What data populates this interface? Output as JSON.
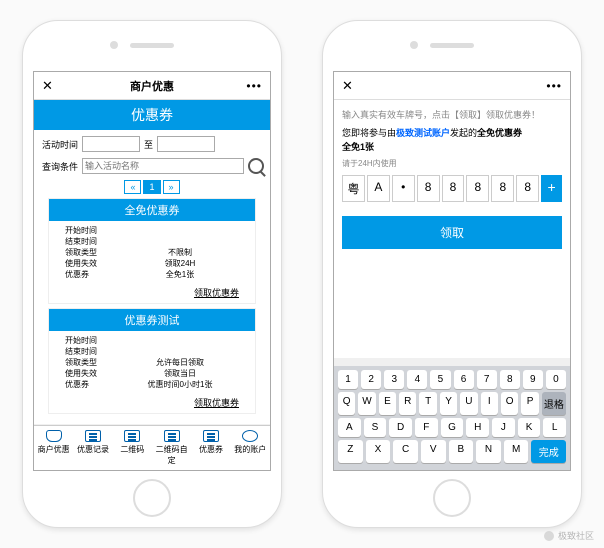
{
  "watermark": "极致社区",
  "left": {
    "nav": {
      "close": "✕",
      "title": "商户优惠",
      "more": "•••"
    },
    "header": "优惠券",
    "searchform": {
      "time_label": "活动时间",
      "to": "至",
      "cond_label": "查询条件",
      "cond_placeholder": "输入活动名称"
    },
    "pager": {
      "prev": "«",
      "page": "1",
      "next": "»"
    },
    "coupons": [
      {
        "title": "全免优惠券",
        "rows": [
          {
            "k": "开始时间",
            "v": ""
          },
          {
            "k": "结束时间",
            "v": ""
          },
          {
            "k": "领取类型",
            "v": "不限制"
          },
          {
            "k": "使用失效",
            "v": "领取24H"
          },
          {
            "k": "优惠券",
            "v": "全免1张"
          }
        ],
        "action": "领取优惠券"
      },
      {
        "title": "优惠券测试",
        "rows": [
          {
            "k": "开始时间",
            "v": ""
          },
          {
            "k": "结束时间",
            "v": ""
          },
          {
            "k": "领取类型",
            "v": "允许每日领取"
          },
          {
            "k": "使用失效",
            "v": "领取当日"
          },
          {
            "k": "优惠券",
            "v": "优惠时间0小时1张"
          }
        ],
        "action": "领取优惠券"
      }
    ],
    "tabs": [
      {
        "label": "商户优惠"
      },
      {
        "label": "优惠记录"
      },
      {
        "label": "二维码"
      },
      {
        "label": "二维码自定"
      },
      {
        "label": "优惠券"
      },
      {
        "label": "我的账户"
      }
    ]
  },
  "right": {
    "nav": {
      "close": "✕",
      "title": "",
      "more": "•••"
    },
    "hint": "输入真实有效车牌号，点击【领取】领取优惠券！",
    "msg_pre": "您即将参与由",
    "msg_account": "极致测试账户",
    "msg_mid": "发起的",
    "msg_coupon": "全免优惠券",
    "msg_qty": "全免1张",
    "sub": "请于24H内使用",
    "plate": [
      "粤",
      "A",
      "•",
      "8",
      "8",
      "8",
      "8",
      "8"
    ],
    "plate_add": "+",
    "claim_btn": "领取",
    "keyboard": {
      "row1": [
        "1",
        "2",
        "3",
        "4",
        "5",
        "6",
        "7",
        "8",
        "9",
        "0"
      ],
      "row2": [
        "Q",
        "W",
        "E",
        "R",
        "T",
        "Y",
        "U",
        "I",
        "O",
        "P",
        "退格"
      ],
      "row3": [
        "A",
        "S",
        "D",
        "F",
        "G",
        "H",
        "J",
        "K",
        "L"
      ],
      "row4": [
        "Z",
        "X",
        "C",
        "V",
        "B",
        "N",
        "M"
      ],
      "done": "完成"
    }
  }
}
